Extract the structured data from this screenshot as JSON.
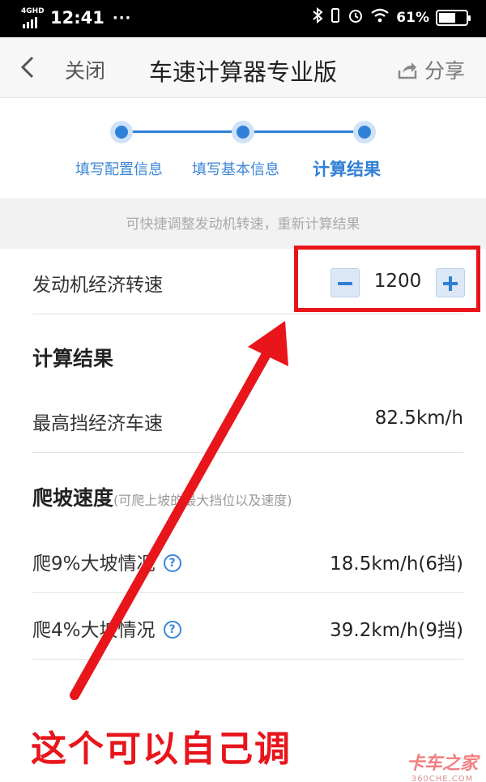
{
  "status_bar": {
    "network": "4GHD",
    "time": "12:41",
    "dots": "···",
    "battery_text": "61%",
    "battery_level": 0.61
  },
  "nav": {
    "back_icon": "chevron-left-icon",
    "close_label": "关闭",
    "title": "车速计算器专业版",
    "share_label": "分享",
    "share_icon": "share-icon"
  },
  "steps": [
    {
      "label": "填写配置信息"
    },
    {
      "label": "填写基本信息"
    },
    {
      "label": "计算结果"
    }
  ],
  "hint": "可快捷调整发动机转速，重新计算结果",
  "engine": {
    "label": "发动机经济转速",
    "value": "1200",
    "minus_icon": "minus-icon",
    "plus_icon": "plus-icon"
  },
  "results": {
    "title": "计算结果",
    "top_gear_label": "最高挡经济车速",
    "top_gear_value": "82.5km/h"
  },
  "climb": {
    "title": "爬坡速度",
    "note": "(可爬上坡的最大挡位以及速度)",
    "rows": [
      {
        "label": "爬9%大坡情况",
        "value": "18.5km/h(6挡)"
      },
      {
        "label": "爬4%大坡情况",
        "value": "39.2km/h(9挡)"
      }
    ]
  },
  "annotation": "这个可以自己调",
  "watermark": {
    "line1": "卡车之家",
    "line2": "360CHE.COM"
  },
  "colors": {
    "accent": "#2f7fd6",
    "annotation_red": "#e8151b"
  }
}
